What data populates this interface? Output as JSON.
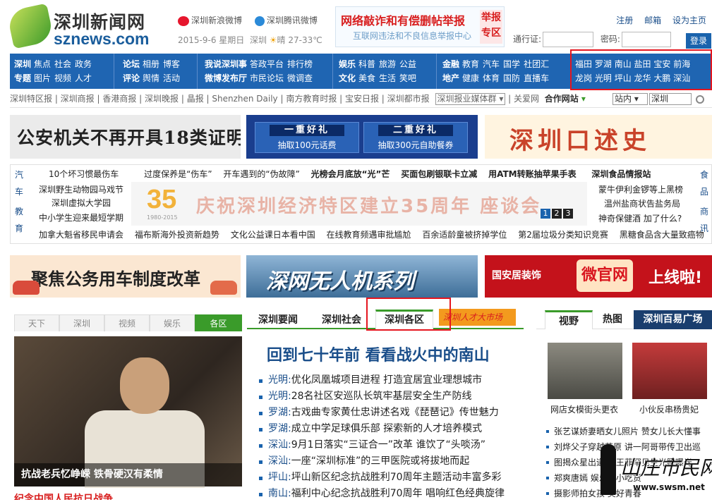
{
  "header": {
    "logo_cn": "深圳新闻网",
    "logo_en": "sznews.com",
    "weibo_sina": "深圳新浪微博",
    "weibo_tencent": "深圳腾讯微博",
    "date": "2015-9-6 星期日",
    "city": "深圳",
    "weather": "晴 27-33℃",
    "report_title": "网络敲诈和有偿删帖举报",
    "report_sub": "互联网违法和不良信息举报中心",
    "report_box": "举报专区",
    "links": [
      "注册",
      "邮箱",
      "设为主页"
    ],
    "pass_label": "通行证:",
    "pwd_label": "密码:",
    "login_btn": "登录"
  },
  "nav": {
    "groups": [
      {
        "r1": [
          "深圳",
          "焦点",
          "社会",
          "政务"
        ],
        "r2": [
          "专题",
          "图片",
          "视频",
          "人才"
        ]
      },
      {
        "r1": [
          "论坛",
          "相册",
          "博客"
        ],
        "r2": [
          "评论",
          "舆情",
          "活动"
        ]
      },
      {
        "r1": [
          "我说深圳事",
          "答政平台",
          "排行榜"
        ],
        "r2": [
          "微博发布厅",
          "市民论坛",
          "微调查"
        ]
      },
      {
        "r1": [
          "娱乐",
          "科普",
          "旅游",
          "公益"
        ],
        "r2": [
          "文化",
          "美食",
          "生活",
          "笑吧"
        ]
      },
      {
        "r1": [
          "金融",
          "教育",
          "汽车",
          "国学",
          "社团汇"
        ],
        "r2": [
          "地产",
          "健康",
          "体育",
          "国防",
          "直播车"
        ]
      }
    ],
    "districts_r1": [
      "福田",
      "罗湖",
      "南山",
      "盐田",
      "宝安",
      "前海"
    ],
    "districts_r2": [
      "龙岗",
      "光明",
      "坪山",
      "龙华",
      "大鹏",
      "深汕"
    ]
  },
  "subnav": {
    "links": "深圳特区报 | 深圳商报 | 香港商报 | 深圳晚报 | 晶报 | Shenzhen Daily | 南方教育时报 | 宝安日报 | 深圳都市报",
    "select1": "深圳报业媒体群",
    "love": "关爱网",
    "partner": "合作网站",
    "scope": "站内",
    "query": "深圳"
  },
  "banners1": {
    "left": "公安机关不再开具18类证明",
    "prize1_t": "一重好礼",
    "prize1_b": "抽取100元话费",
    "prize2_t": "二重好礼",
    "prize2_b": "抽取300元自助餐券",
    "right": "深圳口述史"
  },
  "newsblock": {
    "left_labels": [
      "汽车",
      "教育"
    ],
    "right_labels": [
      "食品",
      "商讯"
    ],
    "row1": [
      "10个坏习惯最伤车",
      "过度保养是“伤车”",
      "开车遇到的“伪故障”",
      "光榜会月底放“光”芒",
      "买面包刷银联卡立减",
      "用ATM转账抽苹果手表",
      "深圳食品情报站"
    ],
    "row2": [
      "深圳野生动物园马戏节",
      "深圳虚拟大学园"
    ],
    "row3": [
      "中小学生迎来最短学期"
    ],
    "row4": [
      "加拿大魁省移民申请会",
      "福布斯海外投资新趋势",
      "文化公益课日本看中国",
      "在线教育频遇审批尴尬",
      "百余适龄童被挤掉学位",
      "第2届垃圾分类知识竞赛",
      "黑糖食品含大量致癌物"
    ],
    "anniv_num": "35",
    "anniv_years": "1980-2015",
    "anniv_text": "庆祝深圳经济特区建立35周年 座谈会",
    "pages": [
      "1",
      "2",
      "3"
    ],
    "right_items": [
      "蒙牛伊利金锣等上黑榜",
      "温州盐商状告盐务局",
      "神奇保健酒 加了什么?"
    ]
  },
  "banners2": {
    "left": "聚焦公务用车制度改革",
    "mid": "深网无人机系列",
    "right_l": "国安居装饰",
    "right_m": "微官网",
    "right_r": "上线啦!"
  },
  "left": {
    "tabs": [
      "天下",
      "深圳",
      "视频",
      "娱乐",
      "各区"
    ],
    "caption": "抗战老兵忆峥嵘 铁骨硬汉有柔情",
    "bottom": "纪念中国人民抗日战争"
  },
  "center": {
    "tabs": [
      "深圳要闻",
      "深圳社会",
      "深圳各区"
    ],
    "talent": "深圳人才大市场",
    "headline": "回到七十年前 看看战火中的南山",
    "items": [
      {
        "d": "光明:",
        "t": "优化凤凰城项目进程 打造宜居宜业理想城市"
      },
      {
        "d": "光明:",
        "t": "28名社区安巡队长筑牢基层安全生产防线"
      },
      {
        "d": "罗湖:",
        "t": "古戏曲专家黄仕忠讲述名戏《琵琶记》传世魅力"
      },
      {
        "d": "罗湖:",
        "t": "成立中学足球俱乐部 探索新的人才培养模式"
      },
      {
        "d": "深汕:",
        "t": "9月1日落实“三证合一”改革 谁饮了“头啖汤”"
      },
      {
        "d": "深汕:",
        "t": "一座“深圳标准”的三甲医院或将拔地而起"
      },
      {
        "d": "坪山:",
        "t": "坪山新区纪念抗战胜利70周年主题活动丰富多彩"
      },
      {
        "d": "南山:",
        "t": "福利中心纪念抗战胜利70周年 唱响红色经典旋律"
      }
    ]
  },
  "right": {
    "tabs": [
      "视野",
      "热图",
      "深圳百易广场"
    ],
    "cap1": "网店女模街头更衣",
    "cap2": "小伙反串杨贵妃",
    "items": [
      "张艺谋娇妻晒女儿照片 赞女儿长大懂事",
      "刘烨父子穿越草原 讲一阿哥带传卫出巡",
      "图揭众星出道 一王菲罕见生光照曝光",
      "郑爽唐嫣 娱乐圈小吃货",
      "摄影师拍女孩 美好青春"
    ]
  },
  "watermark": {
    "text": "山庄市民网",
    "url": "www.swsm.net"
  },
  "colors": {
    "nav_blue": "#1f65b2",
    "accent_green": "#3a9b2a",
    "highlight_red": "#e5161f"
  }
}
